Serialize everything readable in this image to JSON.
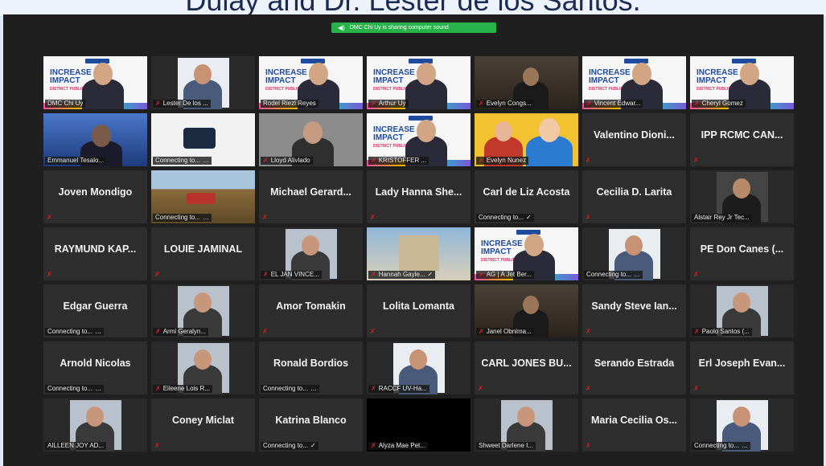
{
  "caption": "Dulay and Dr. Lester de los Santos.",
  "share_banner": {
    "text": "DMC Chi Uy is sharing computer sound",
    "icon": "speaker-icon"
  },
  "colors": {
    "window_bg": "#1f1f1f",
    "tile_bg": "#2e2e2e",
    "active_outline": "#e6d02a",
    "share_green": "#27b24a",
    "muted_red": "#e02020"
  },
  "rows": [
    [
      {
        "label": "DMC Chi Uy",
        "muted": false,
        "video": "slide-person",
        "active": true
      },
      {
        "label": "Lester De los ...",
        "muted": true,
        "video": "portrait-white"
      },
      {
        "label": "Rodel Riezl Reyes",
        "muted": false,
        "video": "slide-person"
      },
      {
        "label": "Arthur Uy",
        "muted": true,
        "video": "slide-person"
      },
      {
        "label": "Evelyn Congs...",
        "muted": true,
        "video": "dark-room"
      },
      {
        "label": "Vincent Edwar...",
        "muted": true,
        "video": "slide-person"
      },
      {
        "label": "Cheryl Gomez",
        "muted": true,
        "video": "slide-person"
      }
    ],
    [
      {
        "label": "Emmanuel Tesalo...",
        "muted": false,
        "video": "blue-photo"
      },
      {
        "label": "Connecting to...",
        "muted": false,
        "video": "white-object",
        "status": "…"
      },
      {
        "label": "Lloyd Alivlado",
        "muted": true,
        "video": "gray-person"
      },
      {
        "label": "KRISTOFFER ...",
        "muted": true,
        "video": "slide-person"
      },
      {
        "label": "Evelyn Nunez",
        "muted": true,
        "video": "yellow"
      },
      {
        "big_name": "Valentino Dioni...",
        "muted": true
      },
      {
        "big_name": "IPP RCMC CAN...",
        "muted": true
      }
    ],
    [
      {
        "big_name": "Joven Mondigo",
        "muted": true
      },
      {
        "label": "Connecting to...",
        "muted": false,
        "video": "field",
        "status": "…"
      },
      {
        "big_name": "Michael Gerard...",
        "muted": true
      },
      {
        "big_name": "Lady Hanna She...",
        "muted": true
      },
      {
        "big_name": "Carl de Liz Acosta",
        "label": "Connecting to...",
        "status": "✓"
      },
      {
        "big_name": "Cecilia D. Larita",
        "muted": true
      },
      {
        "label": "Alstair Rey Jr Tec...",
        "muted": false,
        "video": "dark-portrait"
      }
    ],
    [
      {
        "big_name": "RAYMUND KAP...",
        "muted": true
      },
      {
        "big_name": "LOUIE JAMINAL",
        "muted": true
      },
      {
        "label": "EL JAN VINCE...",
        "muted": true,
        "video": "portrait-light"
      },
      {
        "label": "Hannah Gayle...",
        "muted": true,
        "video": "church",
        "status": "✓"
      },
      {
        "label": "AG | A Jet Ber...",
        "muted": true,
        "video": "slide-person"
      },
      {
        "label": "Connecting to...",
        "muted": false,
        "video": "portrait-white",
        "status": "…"
      },
      {
        "big_name": "PE Don Canes (...",
        "muted": true
      }
    ],
    [
      {
        "big_name": "Edgar Guerra",
        "label": "Connecting to...",
        "status": "…"
      },
      {
        "label": "Armi Geralyn...",
        "muted": true,
        "video": "portrait-light"
      },
      {
        "big_name": "Amor Tomakin",
        "muted": true
      },
      {
        "big_name": "Lolita Lomanta",
        "muted": true
      },
      {
        "label": "Janel Obnima...",
        "muted": true,
        "video": "dark-room"
      },
      {
        "big_name": "Sandy Steve Ian...",
        "muted": true
      },
      {
        "label": "Paolo Santos (...",
        "muted": true,
        "video": "portrait-light"
      }
    ],
    [
      {
        "big_name": "Arnold Nicolas",
        "label": "Connecting to...",
        "status": "…"
      },
      {
        "label": "Eileene Lois R...",
        "muted": true,
        "video": "portrait-light"
      },
      {
        "big_name": "Ronald Bordios",
        "label": "Connecting to...",
        "status": "…"
      },
      {
        "label": "RACCF UV-Ha...",
        "muted": true,
        "video": "portrait-white"
      },
      {
        "big_name": "CARL JONES BU...",
        "muted": true
      },
      {
        "big_name": "Serando Estrada",
        "muted": true
      },
      {
        "big_name": "Erl Joseph Evan...",
        "muted": true
      }
    ],
    [
      {
        "label": "AILLEEN JOY AD...",
        "muted": false,
        "video": "portrait-light"
      },
      {
        "big_name": "Coney Miclat",
        "muted": true
      },
      {
        "big_name": "Katrina Blanco",
        "label": "Connecting to...",
        "status": "✓"
      },
      {
        "label": "Alyza Mae Pet...",
        "muted": true,
        "video": "black"
      },
      {
        "label": "Shweet Darlene I...",
        "muted": false,
        "video": "portrait-light"
      },
      {
        "big_name": "Maria Cecilia Os...",
        "muted": true
      },
      {
        "label": "Connecting to...",
        "muted": false,
        "video": "portrait-white",
        "status": "…"
      }
    ]
  ]
}
